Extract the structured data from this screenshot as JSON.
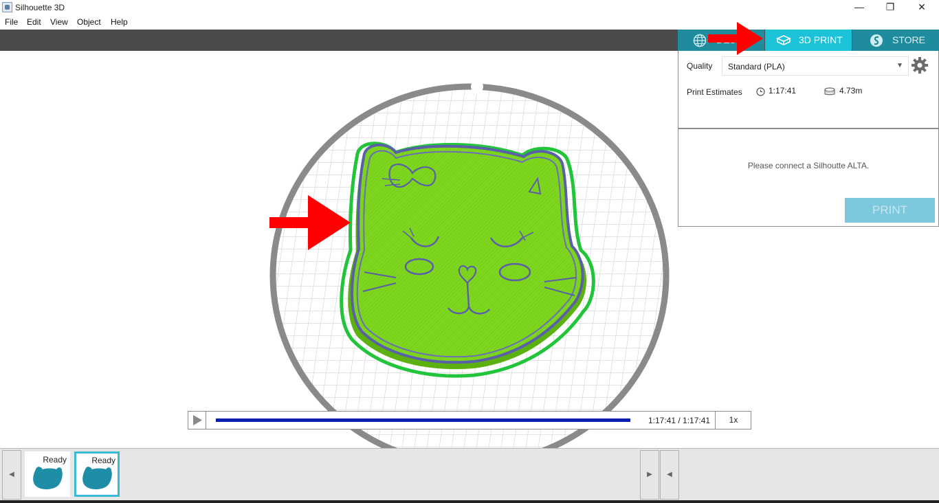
{
  "window": {
    "title": "Silhouette 3D",
    "minimize": "—",
    "restore": "❐",
    "close": "✕"
  },
  "menu": [
    "File",
    "Edit",
    "View",
    "Object",
    "Help"
  ],
  "tabs": [
    {
      "label": "DESIG",
      "icon": "globe-icon",
      "active": false
    },
    {
      "label": "3D PRINT",
      "icon": "cube-icon",
      "active": true
    },
    {
      "label": "STORE",
      "icon": "silhouette-logo-icon",
      "active": false
    }
  ],
  "panel": {
    "quality_label": "Quality",
    "quality_value": "Standard (PLA)",
    "estimates_label": "Print Estimates",
    "time": "1:17:41",
    "filament": "4.73m",
    "connect_message": "Please connect a Silhoutte ALTA.",
    "print_button": "PRINT"
  },
  "playback": {
    "progress": 1.0,
    "time_readout": "1:17:41 / 1:17:41",
    "speed": "1x"
  },
  "tray": {
    "items": [
      {
        "status": "Ready",
        "selected": false
      },
      {
        "status": "Ready",
        "selected": true
      }
    ]
  },
  "colors": {
    "accent": "#1cc2d8",
    "tab_inactive": "#1f8c9d",
    "model_green": "#7fd61e",
    "outline_purple": "#5a5fa8",
    "annotation_red": "#ff0000"
  }
}
